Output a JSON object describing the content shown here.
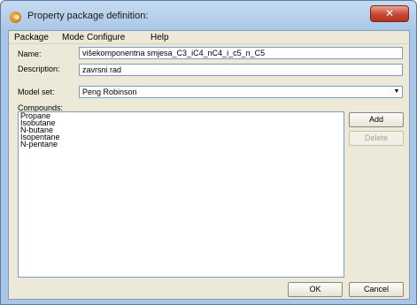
{
  "window": {
    "title": "Property package definition:",
    "close_label": "✕"
  },
  "menu": {
    "items": [
      "Package",
      "Mode",
      "Configure",
      "Help"
    ]
  },
  "form": {
    "name_label": "Name:",
    "name_value": "višekomponentna smjesa_C3_iC4_nC4_i_c5_n_C5",
    "description_label": "Description:",
    "description_value": "zavrsni rad",
    "model_set_label": "Model set:",
    "model_set_value": "Peng Robinson",
    "compounds_label": "Compounds:"
  },
  "compounds": [
    "Propane",
    "Isobutane",
    "N-butane",
    "Isopentane",
    "N-pentane"
  ],
  "buttons": {
    "add": "Add",
    "delete": "Delete",
    "ok": "OK",
    "cancel": "Cancel"
  }
}
